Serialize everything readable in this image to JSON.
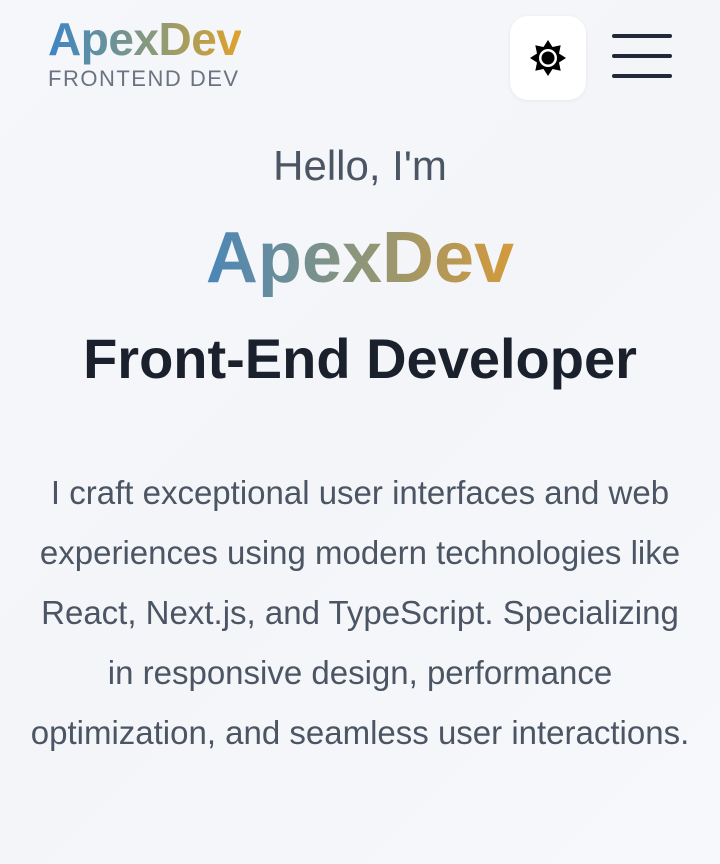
{
  "brand": {
    "name": "ApexDev",
    "tagline": "FRONTEND DEV"
  },
  "header": {
    "theme_toggle_icon": "sun-icon",
    "menu_icon": "hamburger-menu-icon"
  },
  "hero": {
    "greeting": "Hello, I'm",
    "name": "ApexDev",
    "role": "Front-End Developer",
    "description": "I craft exceptional user interfaces and web experiences using modern technologies like React, Next.js, and TypeScript. Specializing in responsive design, performance optimization, and seamless user interactions."
  },
  "colors": {
    "background": "#f5f7fb",
    "gradient_start": "#3d85c6",
    "gradient_end": "#e0a22a",
    "heading": "#1a202c",
    "body_text": "#4b5563"
  }
}
